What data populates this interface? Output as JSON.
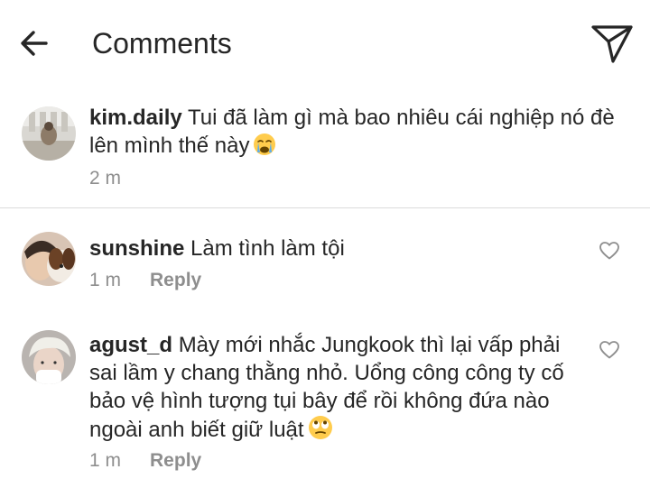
{
  "header": {
    "title": "Comments",
    "back_icon": "arrow-left-icon",
    "share_icon": "paper-plane-icon"
  },
  "caption": {
    "username": "kim.daily",
    "text": "Tui đã làm gì mà bao nhiêu cái nghiệp nó đè lên mình thế này",
    "emoji": "crying-face-emoji",
    "time": "2 m"
  },
  "comments": [
    {
      "username": "sunshine",
      "text": "Làm tình làm tội",
      "time": "1 m",
      "reply_label": "Reply",
      "like_icon": "heart-outline-icon"
    },
    {
      "username": "agust_d",
      "text": "Mày mới nhắc Jungkook thì lại vấp phải sai lầm y chang thằng nhỏ. Uổng công công ty cố bảo vệ hình tượng tụi bây để rồi không đứa nào ngoài anh biết giữ luật",
      "emoji": "eye-roll-emoji",
      "time": "1 m",
      "reply_label": "Reply",
      "like_icon": "heart-outline-icon"
    }
  ],
  "colors": {
    "text": "#262626",
    "meta": "#8e8e8e",
    "divider": "#dbdbdb"
  }
}
